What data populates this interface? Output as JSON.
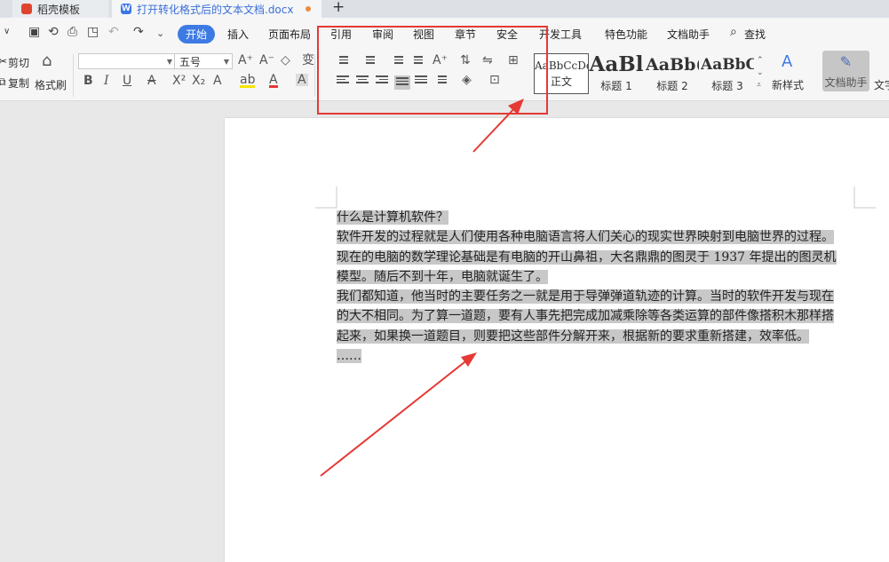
{
  "tabs": [
    {
      "label": "稻壳模板"
    },
    {
      "label": "打开转化格式后的文本文档.docx",
      "logo": "W"
    }
  ],
  "menu": {
    "items": [
      "开始",
      "插入",
      "页面布局",
      "引用",
      "审阅",
      "视图",
      "章节",
      "安全",
      "开发工具",
      "特色功能",
      "文档助手"
    ],
    "active_index": 0,
    "search_label": "查找"
  },
  "ribbon": {
    "cut": "剪切",
    "copy": "复制",
    "format_painter": "格式刷",
    "font_name": "",
    "font_size": "五号",
    "styles": [
      {
        "sample": "AaBbCcDd",
        "label": "正文"
      },
      {
        "sample": "AaBl",
        "label": "标题 1"
      },
      {
        "sample": "AaBb(",
        "label": "标题 2"
      },
      {
        "sample": "AaBbC",
        "label": "标题 3"
      }
    ],
    "new_style": "新样式",
    "doc_helper": "文档助手",
    "text_tools": "文字"
  },
  "document": {
    "lines": [
      "什么是计算机软件？",
      "软件开发的过程就是人们使用各种电脑语言将人们关心的现实世界映射到电脑世界的过程。",
      "现在的电脑的数学理论基础是有电脑的开山鼻祖，大名鼎鼎的图灵于 1937 年提出的图灵机",
      "模型。随后不到十年，电脑就诞生了。",
      "我们都知道，他当时的主要任务之一就是用于导弹弹道轨迹的计算。当时的软件开发与现在",
      "的大不相同。为了算一道题，要有人事先把完成加减乘除等各类运算的部件像搭积木那样搭",
      "起来，如果换一道题目，则要把这些部件分解开来，根据新的要求重新搭建，效率低。",
      "……"
    ]
  },
  "colors": {
    "accent": "#3d7be3",
    "highlight": "#e53935",
    "selection": "#c8c8c8"
  }
}
